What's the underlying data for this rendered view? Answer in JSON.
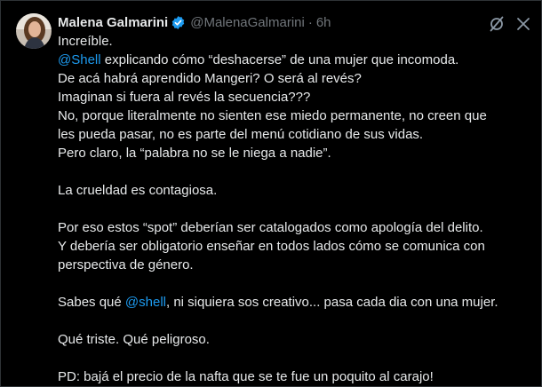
{
  "tweet": {
    "display_name": "Malena Galmarini",
    "handle": "@MalenaGalmarini",
    "separator": "·",
    "timestamp": "6h",
    "body": {
      "l1": "Increíble.",
      "l2_mention": "@Shell",
      "l2_rest": " explicando cómo “deshacerse” de una mujer que incomoda.",
      "l3": "De acá habrá aprendido Mangeri? O será al revés?",
      "l4": "Imaginan si fuera al revés la secuencia???",
      "l5": "No, porque literalmente no sienten ese miedo permanente, no creen que",
      "l6": "les pueda pasar, no es parte del menú cotidiano de sus vidas.",
      "l7": "Pero claro, la “palabra no se le niega a nadie”.",
      "l8": "La crueldad es contagiosa.",
      "l9": "Por eso estos “spot” deberían ser catalogados como apología del delito.",
      "l10": "Y debería ser obligatorio enseñar en todos lados cómo se comunica con",
      "l11": "perspectiva de género.",
      "l12_pre": "Sabes qué ",
      "l12_mention": "@shell",
      "l12_rest": ", ni siquiera sos creativo... pasa cada dia con una mujer.",
      "l13": "Qué triste. Qué peligroso.",
      "l14": "PD: bajá el precio de la nafta que se te fue un poquito al carajo!"
    }
  },
  "icons": {
    "verified": "verified-badge-icon",
    "grok": "grok-icon",
    "close": "close-icon"
  },
  "colors": {
    "background": "#000000",
    "text": "#e7e9ea",
    "secondary_text": "#71767b",
    "accent": "#1d9bf0",
    "border": "#2f3336"
  }
}
